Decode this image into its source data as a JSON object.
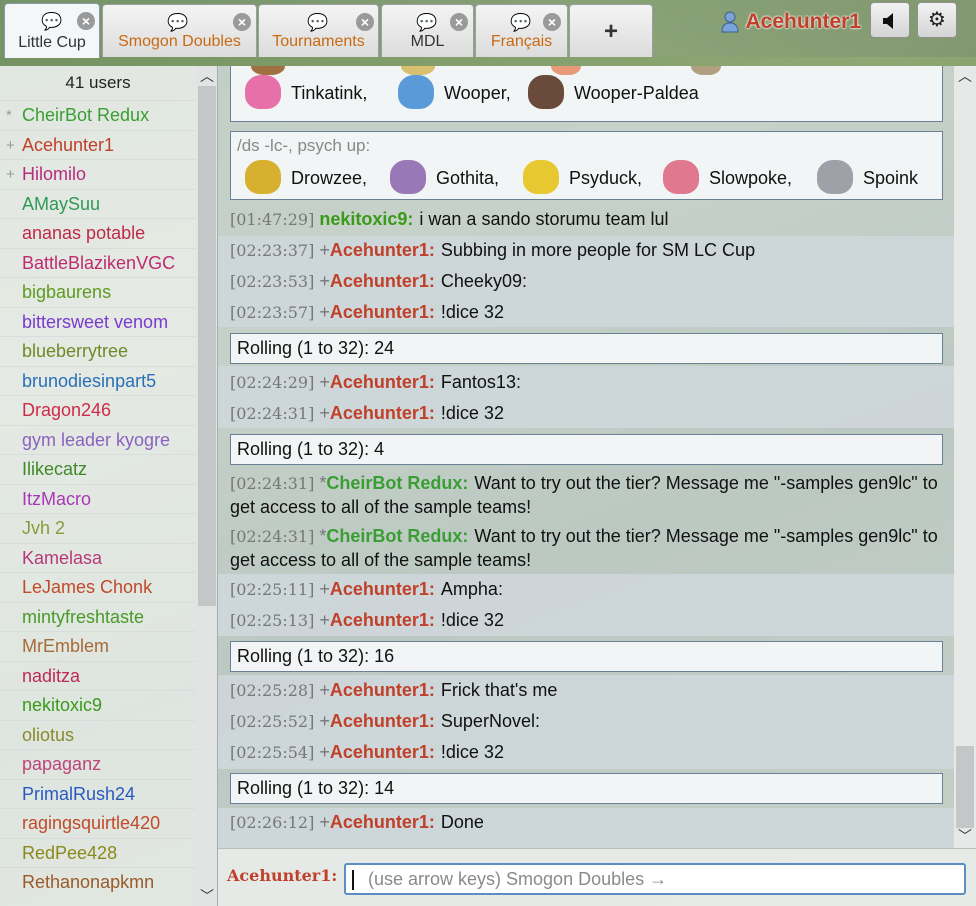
{
  "tabs": [
    {
      "label": "Little Cup",
      "type": "battle",
      "active": true,
      "closable": true
    },
    {
      "label": "Smogon Doubles",
      "type": "room",
      "active": false,
      "closable": true
    },
    {
      "label": "Tournaments",
      "type": "room",
      "active": false,
      "closable": true
    },
    {
      "label": "MDL",
      "type": "pm",
      "active": false,
      "closable": true
    },
    {
      "label": "Français",
      "type": "room",
      "active": false,
      "closable": true
    }
  ],
  "new_tab_label": "+",
  "top": {
    "username": "Acehunter1",
    "sound_icon": "speaker-icon",
    "settings_icon": "gear-icon"
  },
  "userlist": {
    "count": "41 users",
    "users": [
      {
        "rank": "*",
        "name": "CheirBot Redux",
        "color": "#3a9e34"
      },
      {
        "rank": "+",
        "name": "Acehunter1",
        "color": "#c0402a"
      },
      {
        "rank": "+",
        "name": "Hilomilo",
        "color": "#b82c7e"
      },
      {
        "rank": "",
        "name": "AMaySuu",
        "color": "#2f9a57"
      },
      {
        "rank": "",
        "name": "ananas potable",
        "color": "#c02a48"
      },
      {
        "rank": "",
        "name": "BattleBlazikenVGC",
        "color": "#c02a70"
      },
      {
        "rank": "",
        "name": "bigbaurens",
        "color": "#5f9a22"
      },
      {
        "rank": "",
        "name": "bittersweet venom",
        "color": "#7a3ad0"
      },
      {
        "rank": "",
        "name": "blueberrytree",
        "color": "#6f8a28"
      },
      {
        "rank": "",
        "name": "brunodiesinpart5",
        "color": "#2a70b8"
      },
      {
        "rank": "",
        "name": "Dragon246",
        "color": "#d02a4a"
      },
      {
        "rank": "",
        "name": "gym leader kyogre",
        "color": "#8a62c0"
      },
      {
        "rank": "",
        "name": "Ilikecatz",
        "color": "#3e8a28"
      },
      {
        "rank": "",
        "name": "ItzMacro",
        "color": "#a838b8"
      },
      {
        "rank": "",
        "name": "Jvh 2",
        "color": "#8a9a3a"
      },
      {
        "rank": "",
        "name": "Kamelasa",
        "color": "#b8387a"
      },
      {
        "rank": "",
        "name": "LeJames Chonk",
        "color": "#c04a2a"
      },
      {
        "rank": "",
        "name": "mintyfreshtaste",
        "color": "#4a9a2a"
      },
      {
        "rank": "",
        "name": "MrEmblem",
        "color": "#a86a3a"
      },
      {
        "rank": "",
        "name": "naditza",
        "color": "#c02a58"
      },
      {
        "rank": "",
        "name": "nekitoxic9",
        "color": "#3a9a1a"
      },
      {
        "rank": "",
        "name": "oliotus",
        "color": "#8a8a2a"
      },
      {
        "rank": "",
        "name": "papaganz",
        "color": "#c0447a"
      },
      {
        "rank": "",
        "name": "PrimalRush24",
        "color": "#2a5ac0"
      },
      {
        "rank": "",
        "name": "ragingsquirtle420",
        "color": "#c04a2a"
      },
      {
        "rank": "",
        "name": "RedPee428",
        "color": "#8a8a1a"
      },
      {
        "rank": "",
        "name": "Rethanonapkmn",
        "color": "#9a5a2a"
      }
    ]
  },
  "chat": {
    "top_box": {
      "mons": [
        {
          "name": "Tinkatink,",
          "color": "#e870a8"
        },
        {
          "name": "Wooper,",
          "color": "#5a9ad8"
        },
        {
          "name": "Wooper-Paldea",
          "color": "#6a4a3a"
        }
      ]
    },
    "ds_box": {
      "command": "/ds -lc-, psych up:",
      "mons": [
        {
          "name": "Drowzee,",
          "color": "#d8b030"
        },
        {
          "name": "Gothita,",
          "color": "#9a78b8"
        },
        {
          "name": "Psyduck,",
          "color": "#e8c830"
        },
        {
          "name": "Slowpoke,",
          "color": "#e07890"
        },
        {
          "name": "Spoink",
          "color": "#a0a0a8"
        }
      ]
    },
    "messages": [
      {
        "time": "[01:47:29]",
        "rank": "",
        "name": "nekitoxic9:",
        "color": "#3a9a1a",
        "text": "i wan a sando storumu team lul"
      },
      {
        "time": "[02:23:37]",
        "rank": "+",
        "name": "Acehunter1:",
        "color": "#c0402a",
        "text": "Subbing in more people for SM LC Cup"
      },
      {
        "time": "[02:23:53]",
        "rank": "+",
        "name": "Acehunter1:",
        "color": "#c0402a",
        "text": "Cheeky09:"
      },
      {
        "time": "[02:23:57]",
        "rank": "+",
        "name": "Acehunter1:",
        "color": "#c0402a",
        "text": "!dice 32"
      },
      {
        "time": "[02:24:29]",
        "rank": "+",
        "name": "Acehunter1:",
        "color": "#c0402a",
        "text": "Fantos13:"
      },
      {
        "time": "[02:24:31]",
        "rank": "+",
        "name": "Acehunter1:",
        "color": "#c0402a",
        "text": "!dice 32"
      },
      {
        "time": "[02:24:31]",
        "rank": "*",
        "name": "CheirBot Redux:",
        "color": "#3a9e34",
        "text": "Want to try out the tier? Message me \"-samples gen9lc\" to get access to all of the sample teams!"
      },
      {
        "time": "[02:24:31]",
        "rank": "*",
        "name": "CheirBot Redux:",
        "color": "#3a9e34",
        "text": "Want to try out the tier? Message me \"-samples gen9lc\" to get access to all of the sample teams!"
      },
      {
        "time": "[02:25:11]",
        "rank": "+",
        "name": "Acehunter1:",
        "color": "#c0402a",
        "text": "Ampha:"
      },
      {
        "time": "[02:25:13]",
        "rank": "+",
        "name": "Acehunter1:",
        "color": "#c0402a",
        "text": "!dice 32"
      },
      {
        "time": "[02:25:28]",
        "rank": "+",
        "name": "Acehunter1:",
        "color": "#c0402a",
        "text": "Frick that's me"
      },
      {
        "time": "[02:25:52]",
        "rank": "+",
        "name": "Acehunter1:",
        "color": "#c0402a",
        "text": "SuperNovel:"
      },
      {
        "time": "[02:25:54]",
        "rank": "+",
        "name": "Acehunter1:",
        "color": "#c0402a",
        "text": "!dice 32"
      },
      {
        "time": "[02:26:12]",
        "rank": "+",
        "name": "Acehunter1:",
        "color": "#c0402a",
        "text": "Done"
      }
    ],
    "dice_results": [
      "Rolling (1 to 32): 24",
      "Rolling (1 to 32): 4",
      "Rolling (1 to 32): 16",
      "Rolling (1 to 32): 14"
    ]
  },
  "input": {
    "label": "Acehunter1:",
    "placeholder": "(use arrow keys) Smogon Doubles →"
  }
}
